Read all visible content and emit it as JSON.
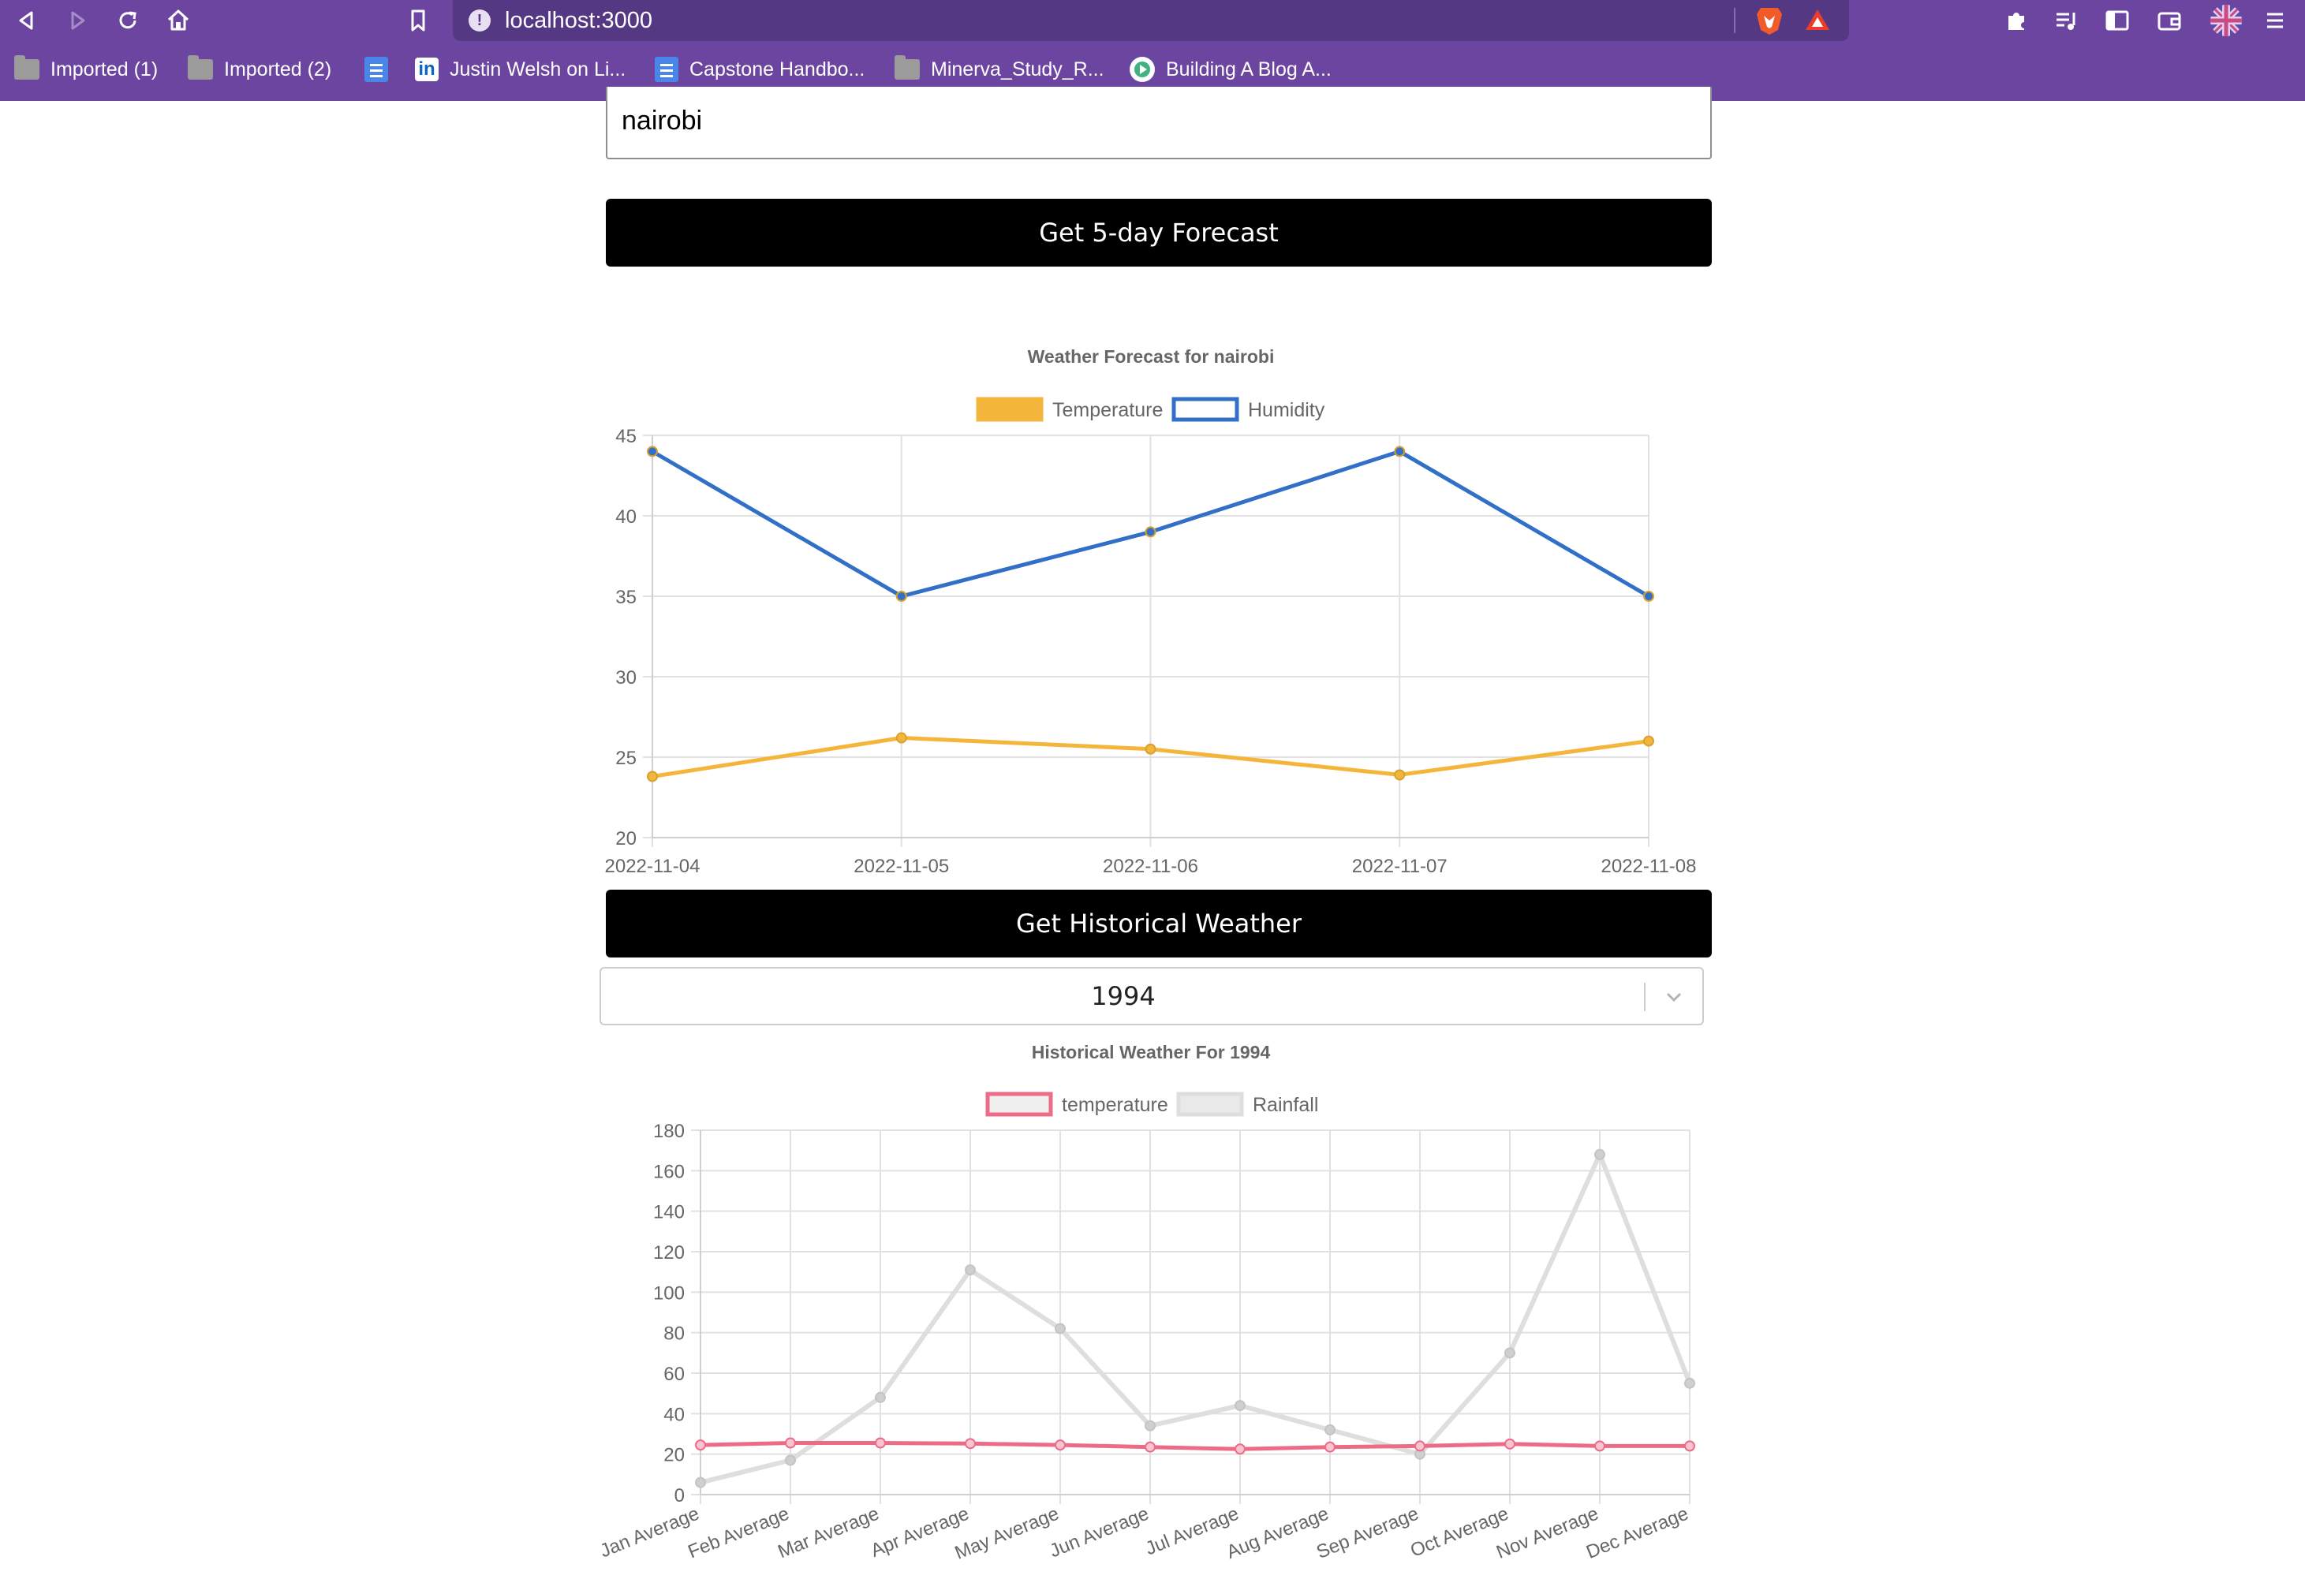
{
  "browser": {
    "url": "localhost:3000",
    "bookmarks": [
      {
        "label": "Imported (1)",
        "icon": "folder-icon"
      },
      {
        "label": "Imported (2)",
        "icon": "folder-icon"
      },
      {
        "label": "",
        "icon": "doc-icon"
      },
      {
        "label": "Justin Welsh on Li...",
        "icon": "linkedin-icon"
      },
      {
        "label": "Capstone Handbo...",
        "icon": "doc-icon"
      },
      {
        "label": "Minerva_Study_R...",
        "icon": "folder-icon"
      },
      {
        "label": "Building A Blog A...",
        "icon": "play-icon"
      }
    ]
  },
  "form": {
    "city_value": "nairobi",
    "forecast_button": "Get 5-day Forecast",
    "historical_button": "Get Historical Weather",
    "year_selected": "1994"
  },
  "colors": {
    "temperature_forecast": "#f4b63a",
    "humidity_forecast": "#3270c8",
    "temperature_hist": "#ee6b88",
    "rainfall_hist": "#dedede"
  },
  "chart_data": [
    {
      "type": "line",
      "title": "Weather Forecast for nairobi",
      "x": [
        "2022-11-04",
        "2022-11-05",
        "2022-11-06",
        "2022-11-07",
        "2022-11-08"
      ],
      "series": [
        {
          "name": "Temperature",
          "values": [
            23.8,
            26.2,
            25.5,
            23.9,
            26.0
          ]
        },
        {
          "name": "Humidity",
          "values": [
            44,
            35,
            39,
            44,
            35
          ]
        }
      ],
      "yticks": [
        20,
        25,
        30,
        35,
        40,
        45
      ],
      "ylim": [
        20,
        45
      ],
      "grid": true,
      "legend": "top-center"
    },
    {
      "type": "line",
      "title": "Historical Weather For 1994",
      "x": [
        "Jan Average",
        "Feb Average",
        "Mar Average",
        "Apr Average",
        "May Average",
        "Jun Average",
        "Jul Average",
        "Aug Average",
        "Sep Average",
        "Oct Average",
        "Nov Average",
        "Dec Average"
      ],
      "series": [
        {
          "name": "temperature",
          "values": [
            24.5,
            25.5,
            25.5,
            25.2,
            24.5,
            23.5,
            22.5,
            23.5,
            24,
            25,
            24,
            24
          ]
        },
        {
          "name": "Rainfall",
          "values": [
            6,
            17,
            48,
            111,
            82,
            34,
            44,
            32,
            20,
            70,
            168,
            55
          ]
        }
      ],
      "yticks": [
        0,
        20,
        40,
        60,
        80,
        100,
        120,
        140,
        160,
        180
      ],
      "ylim": [
        0,
        180
      ],
      "grid": true,
      "legend": "top-center"
    }
  ]
}
